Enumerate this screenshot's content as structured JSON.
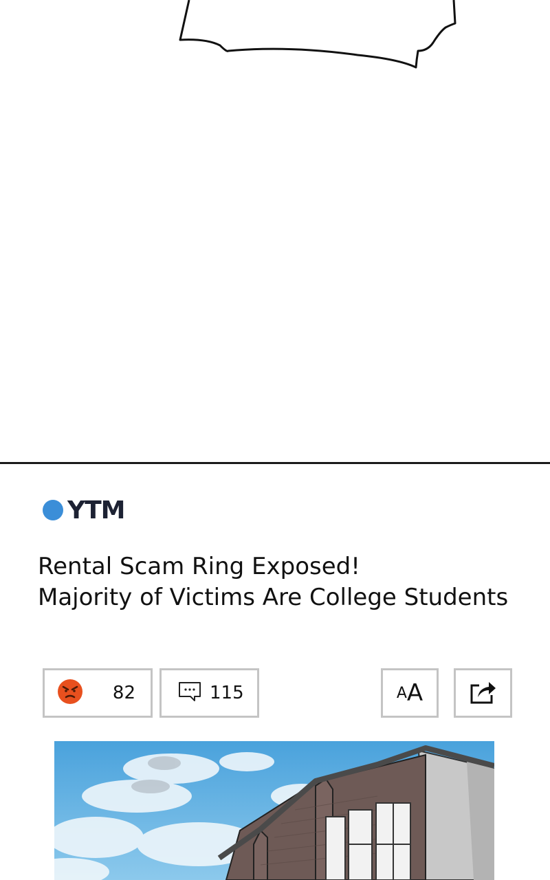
{
  "article": {
    "source": "YTM",
    "headline_line1": "Rental Scam Ring Exposed!",
    "headline_line2": "Majority of Victims Are College Students"
  },
  "toolbar": {
    "reaction_icon": "angry-face-icon",
    "reaction_count": "82",
    "comment_icon": "comment-bubble-icon",
    "comment_count": "115",
    "font_size_small": "A",
    "font_size_large": "A",
    "share_icon": "share-icon"
  },
  "colors": {
    "source_dot": "#3b8ed8",
    "reaction_icon": "#e8501e",
    "button_border": "#c4c4c4"
  }
}
